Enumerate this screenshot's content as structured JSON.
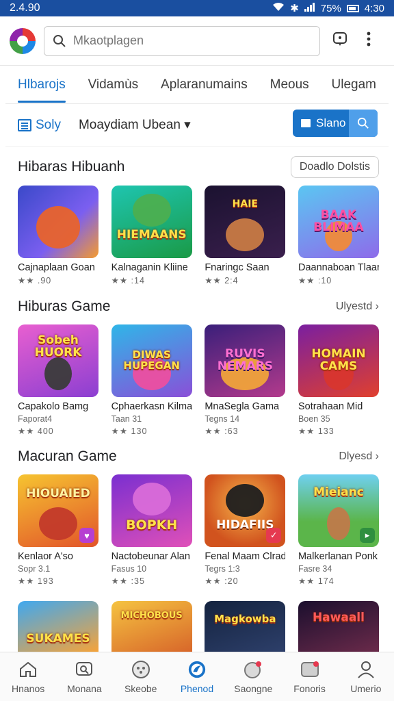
{
  "status": {
    "time": "2.4.90",
    "battery": "75%",
    "clock": "4:30"
  },
  "appbar": {
    "search_placeholder": "Mkaotplagen"
  },
  "tabs": [
    "Hlbarojs",
    "Vidamùs",
    "Aplaranumains",
    "Meous",
    "Ulegam"
  ],
  "filter": {
    "sort_label": "Soly",
    "dropdown_label": "Moaydiam Ubean",
    "dropdown_caret": "▾",
    "search_button": "Slano"
  },
  "sections": [
    {
      "title": "Hibaras Hibuanh",
      "action": "Doadlo Dolstis",
      "items": [
        {
          "name": "Cajnaplaan Goan",
          "rating": "★★ .90",
          "art": ""
        },
        {
          "name": "Kalnaganin Kliine",
          "rating": "★★ :14",
          "art": "HIEMAANS"
        },
        {
          "name": "Fnaringc Saan",
          "rating": "★★ 2:4",
          "art": "HAIE"
        },
        {
          "name": "Daannaboan Tlaarit",
          "rating": "★★ :10",
          "art": "BAAK BLIMAA"
        }
      ]
    },
    {
      "title": "Hiburas Game",
      "action": "Ulyestd ›",
      "items": [
        {
          "name": "Capakolo Bamg",
          "sub": "Faporat4",
          "rating": "★★ 400",
          "art": "Sobeh HUORK"
        },
        {
          "name": "Cphaerkasn Kilma",
          "sub": "Taan 31",
          "rating": "★★ 130",
          "art": "DIWAS HUPEGAN"
        },
        {
          "name": "MnaSegla Gama",
          "sub": "Tegns 14",
          "rating": "★★ :63",
          "art": "RUVIS NEMARS"
        },
        {
          "name": "Sotrahaan Mid",
          "sub": "Boen 35",
          "rating": "★★ 133",
          "art": "HOMAIN CAMS"
        }
      ]
    },
    {
      "title": "Macuran Game",
      "action": "Dlyesd ›",
      "items": [
        {
          "name": "Kenlaor A'so",
          "sub": "Sopr 3.1",
          "rating": "★★ 193",
          "art": "HIOUAIED"
        },
        {
          "name": "Nactobeunar Alan",
          "sub": "Fasus 10",
          "rating": "★★ :35",
          "art": "BOPKH"
        },
        {
          "name": "Fenal Maam Clrad",
          "sub": "Tegrs 1:3",
          "rating": "★★ :20",
          "art": "HIDAFIIS"
        },
        {
          "name": "Malkerlanan Ponk",
          "sub": "Fasre 34",
          "rating": "★★ 174",
          "art": "Mieianc"
        }
      ]
    },
    {
      "items": [
        {
          "art": "SUKAMES"
        },
        {
          "art": "MICHOBOUS"
        },
        {
          "art": "Magkowba"
        },
        {
          "art": "Hawaall"
        }
      ]
    }
  ],
  "bottom_nav": [
    "Hnanos",
    "Monana",
    "Skeobe",
    "Phenod",
    "Saongne",
    "Fonoris",
    "Umerio"
  ],
  "colors": {
    "brand_blue": "#1a73c8",
    "status_bar": "#1a4fa0",
    "star": "#f2b01e"
  }
}
